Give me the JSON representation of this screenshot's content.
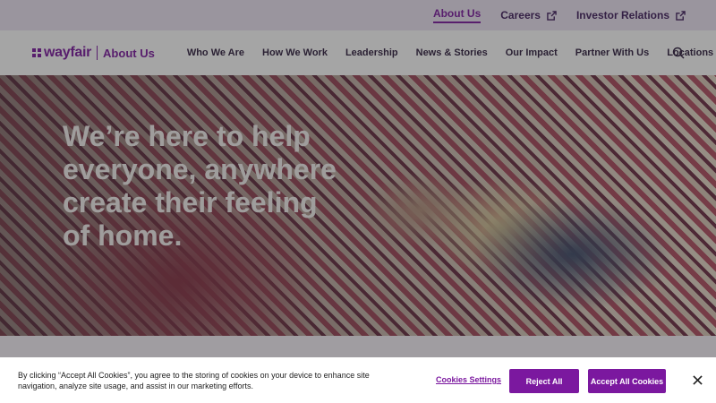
{
  "topbar": {
    "links": [
      {
        "label": "About Us",
        "active": true
      },
      {
        "label": "Careers",
        "external": true
      },
      {
        "label": "Investor Relations",
        "external": true
      }
    ]
  },
  "header": {
    "logo_word": "wayfair",
    "logo_sub": "About Us",
    "nav": [
      "Who We Are",
      "How We Work",
      "Leadership",
      "News & Stories",
      "Our Impact",
      "Partner With Us",
      "Locations"
    ],
    "search_icon": "search-icon"
  },
  "hero": {
    "title": "We’re here to help everyone, anywhere create their feeling of home."
  },
  "cookie_banner": {
    "text": "By clicking “Accept All Cookies”, you agree to the storing of cookies on your device to enhance site navigation, analyze site usage, and assist in our marketing efforts.",
    "settings_label": "Cookies Settings",
    "reject_label": "Reject All",
    "accept_label": "Accept All Cookies",
    "close_icon": "close-icon"
  },
  "colors": {
    "brand": "#7b189f",
    "topbar_bg": "#ece4f3"
  }
}
